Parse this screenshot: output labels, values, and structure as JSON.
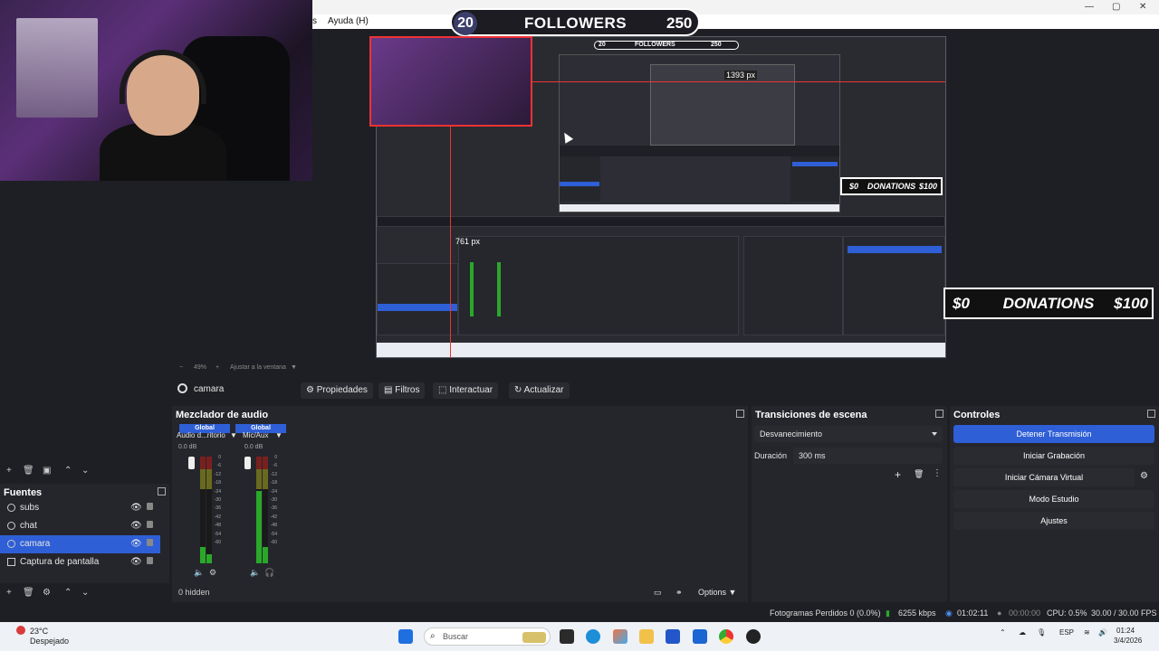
{
  "window": {
    "menu_help": "Ayuda (H)"
  },
  "followers": {
    "current": "20",
    "label": "FOLLOWERS",
    "goal": "250"
  },
  "preview": {
    "nested_followers": {
      "current": "20",
      "label": "FOLLOWERS",
      "goal": "250"
    },
    "px_label_a": "1393 px",
    "px_label_b": "761 px",
    "zoom_text": "49%",
    "fit_text": "Ajustar a la ventana"
  },
  "donations_small": {
    "min": "$0",
    "label": "DONATIONS",
    "max": "$100"
  },
  "donations_big": {
    "min": "$0",
    "label": "DONATIONS",
    "max": "$100"
  },
  "source_toolbar": {
    "selected_source": "camara",
    "properties": "Propiedades",
    "filters": "Filtros",
    "interact": "Interactuar",
    "refresh": "Actualizar"
  },
  "sources": {
    "title": "Fuentes",
    "items": [
      {
        "label": "subs",
        "selected": false
      },
      {
        "label": "chat",
        "selected": false
      },
      {
        "label": "camara",
        "selected": true
      },
      {
        "label": "Captura de pantalla",
        "selected": false
      }
    ]
  },
  "mixer": {
    "title": "Mezclador de audio",
    "channels": [
      {
        "tag": "Global",
        "name": "Audio d...ritorio",
        "db": "0.0 dB"
      },
      {
        "tag": "Global",
        "name": "Mic/Aux",
        "db": "0.0 dB"
      }
    ],
    "scale": [
      "0",
      "-6",
      "-12",
      "-18",
      "-24",
      "-30",
      "-36",
      "-42",
      "-48",
      "-54",
      "-60"
    ],
    "hidden": "0 hidden",
    "options": "Options"
  },
  "transitions": {
    "title": "Transiciones de escena",
    "type": "Desvanecimiento",
    "duration_label": "Duración",
    "duration_value": "300 ms"
  },
  "controls": {
    "title": "Controles",
    "stop_stream": "Detener Transmisión",
    "start_recording": "Iniciar Grabación",
    "start_virtual_cam": "Iniciar Cámara Virtual",
    "studio_mode": "Modo Estudio",
    "settings": "Ajustes"
  },
  "status": {
    "dropped_frames": "Fotogramas Perdidos 0 (0.0%)",
    "bitrate": "6255 kbps",
    "stream_time": "01:02:11",
    "rec_time": "00:00:00",
    "cpu": "CPU: 0.5%",
    "fps": "30.00 / 30.00 FPS"
  },
  "taskbar": {
    "weather_temp": "23°C",
    "weather_desc": "Despejado",
    "search_placeholder": "Buscar",
    "lang": "ESP",
    "time": "01:24",
    "date": "3/4/2026",
    "accent": "#2f5fd6"
  }
}
